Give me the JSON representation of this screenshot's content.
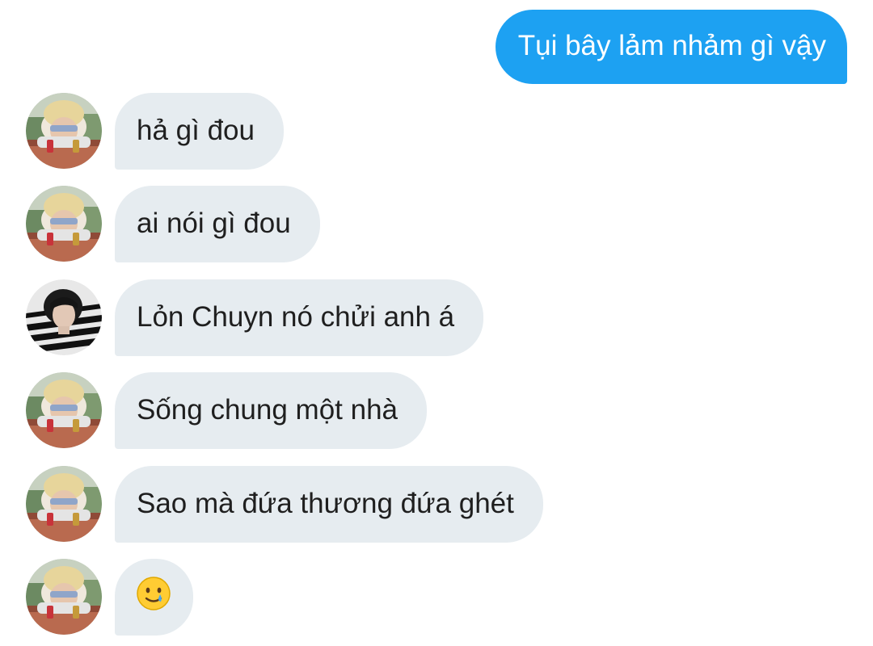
{
  "conversation": {
    "outgoing": {
      "text": "Tụi bây lảm nhảm gì vậy"
    },
    "incoming": [
      {
        "avatar": "blonde-user-avatar",
        "text": "hả gì đou"
      },
      {
        "avatar": "blonde-user-avatar",
        "text": "ai nói gì đou"
      },
      {
        "avatar": "dark-hair-user-avatar",
        "text": "Lỏn Chuyn nó chửi anh á"
      },
      {
        "avatar": "blonde-user-avatar",
        "text": "Sống chung một nhà"
      },
      {
        "avatar": "blonde-user-avatar",
        "text": "Sao mà đứa thương đứa ghét"
      },
      {
        "avatar": "blonde-user-avatar",
        "text": "",
        "emoji": "smiling-face-with-tear"
      }
    ]
  },
  "colors": {
    "outgoing_bubble": "#1da1f2",
    "incoming_bubble": "#e6ecf0",
    "incoming_text": "#1f1f1f",
    "outgoing_text": "#ffffff"
  }
}
